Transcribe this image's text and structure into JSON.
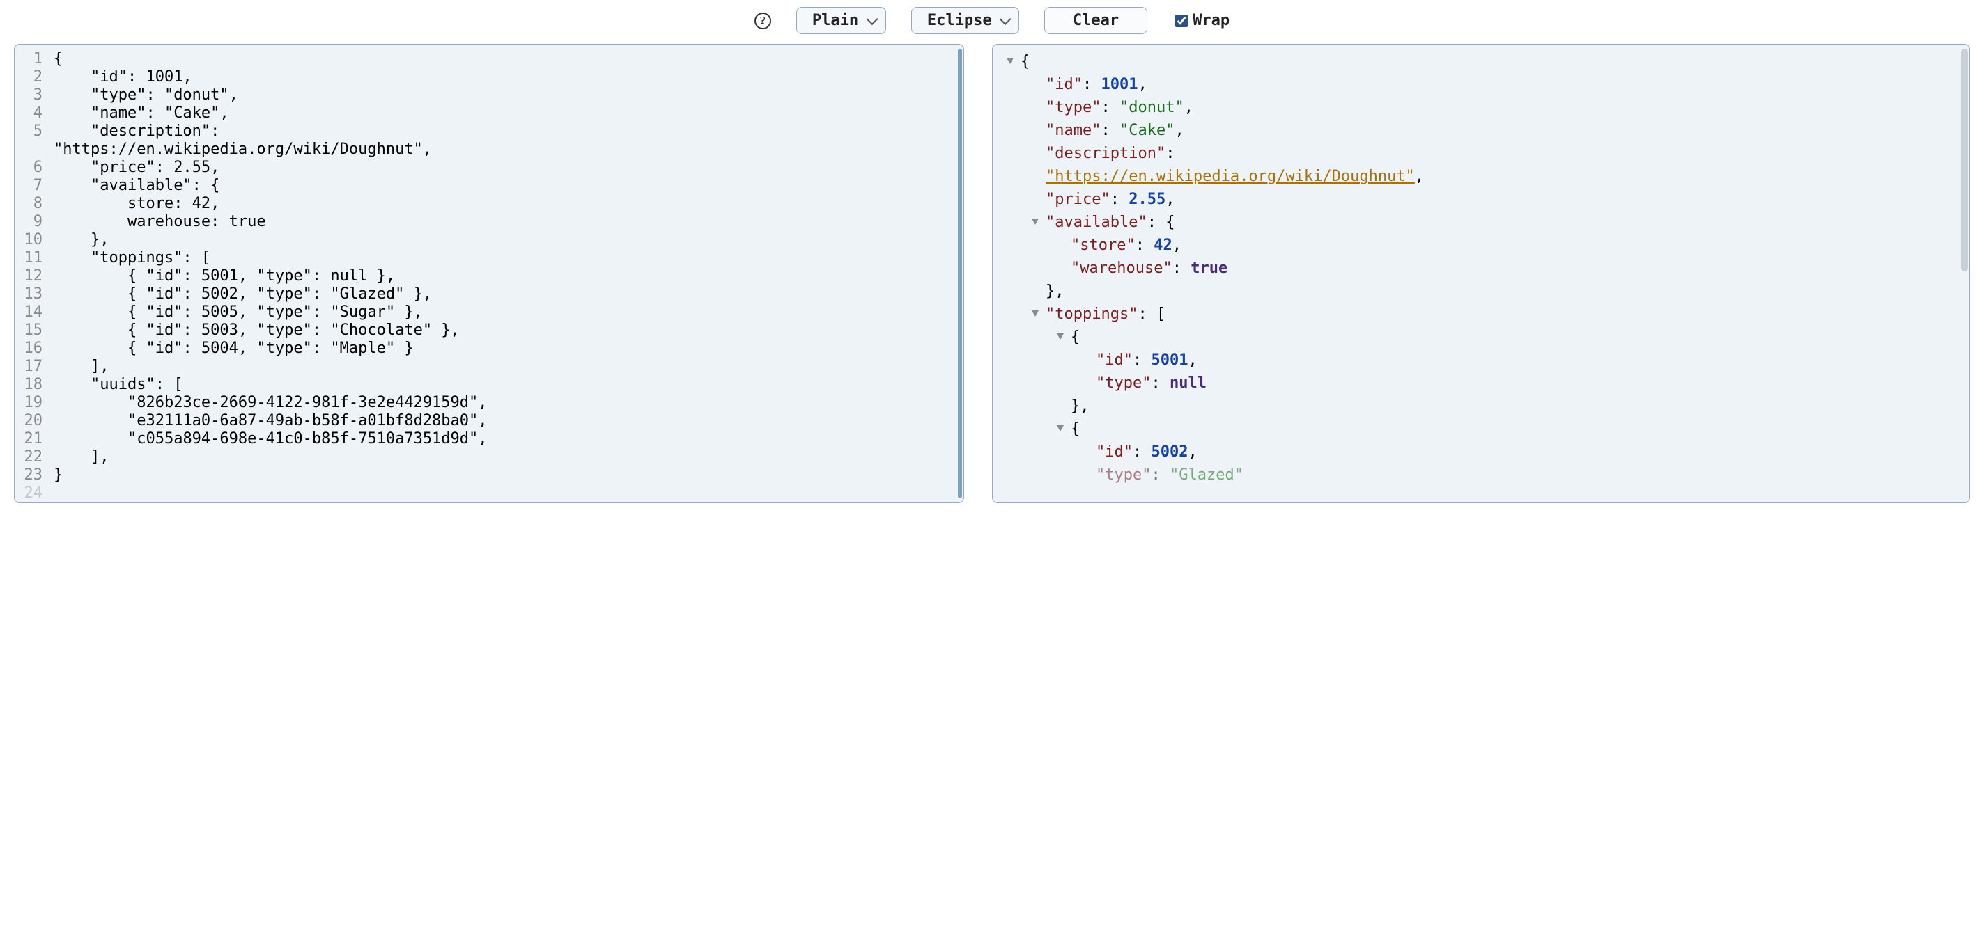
{
  "toolbar": {
    "help_tooltip": "?",
    "indent_select": "Plain",
    "theme_select": "Eclipse",
    "clear_label": "Clear",
    "wrap_label": "Wrap",
    "wrap_checked": true
  },
  "editor": {
    "line_count_visible": 24,
    "lines": [
      "{",
      "    \"id\": 1001,",
      "    \"type\": \"donut\",",
      "    \"name\": \"Cake\",",
      "    \"description\": \"https://en.wikipedia.org/wiki/Doughnut\",",
      "    \"price\": 2.55,",
      "    \"available\": {",
      "        store: 42,",
      "        warehouse: true",
      "    },",
      "    \"toppings\": [",
      "        { \"id\": 5001, \"type\": null },",
      "        { \"id\": 5002, \"type\": \"Glazed\" },",
      "        { \"id\": 5005, \"type\": \"Sugar\" },",
      "        { \"id\": 5003, \"type\": \"Chocolate\" },",
      "        { \"id\": 5004, \"type\": \"Maple\" }",
      "    ],",
      "    \"uuids\": [",
      "        \"826b23ce-2669-4122-981f-3e2e4429159d\",",
      "        \"e32111a0-6a87-49ab-b58f-a01bf8d28ba0\",",
      "        \"c055a894-698e-41c0-b85f-7510a7351d9d\",",
      "    ],",
      "}"
    ]
  },
  "viewer": {
    "root_open": "{",
    "entries": {
      "id_key": "\"id\"",
      "id_val": "1001",
      "type_key": "\"type\"",
      "type_val": "\"donut\"",
      "name_key": "\"name\"",
      "name_val": "\"Cake\"",
      "desc_key": "\"description\"",
      "desc_val": "\"https://en.wikipedia.org/wiki/Doughnut\"",
      "price_key": "\"price\"",
      "price_val": "2.55",
      "avail_key": "\"available\"",
      "avail_open": "{",
      "store_key": "\"store\"",
      "store_val": "42",
      "wh_key": "\"warehouse\"",
      "wh_val": "true",
      "avail_close": "},",
      "top_key": "\"toppings\"",
      "top_open": "[",
      "obj_open": "{",
      "obj_close": "},",
      "t1_id_key": "\"id\"",
      "t1_id_val": "5001",
      "t1_type_key": "\"type\"",
      "t1_type_val": "null",
      "t2_id_key": "\"id\"",
      "t2_id_val": "5002",
      "t2_type_key": "\"type\"",
      "t2_type_val": "\"Glazed\""
    }
  }
}
